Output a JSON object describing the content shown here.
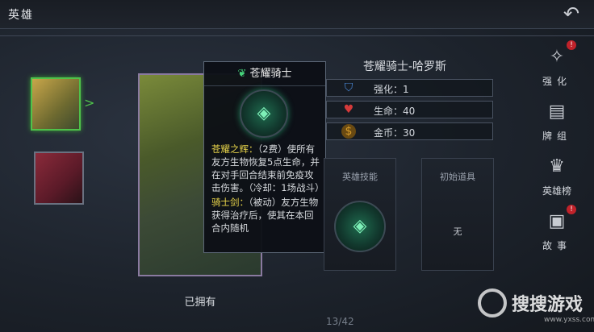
{
  "topbar": {
    "title": "英雄",
    "back_icon": "back-arrow-icon"
  },
  "hero_list": {
    "items": [
      {
        "name": "hero-thumb-knight",
        "selected": true
      },
      {
        "name": "hero-thumb-dark",
        "selected": false
      }
    ]
  },
  "hero_card": {
    "owned_label": "已拥有",
    "page_count": "13/42"
  },
  "tooltip": {
    "title": "苍耀骑士",
    "skill1_name": "苍耀之辉：",
    "skill1_text": "（2费）使所有友方生物恢复5点生命，并在对手回合结束前免疫攻击伤害。（冷却：1场战斗）",
    "skill2_name": "骑士剑：",
    "skill2_text": "（被动）友方生物获得治疗后，使其在本回合内随机"
  },
  "hero_info": {
    "name": "苍耀骑士-哈罗斯",
    "stats": [
      {
        "label": "强化：1",
        "icon": "shield-icon",
        "color": "#4a8ad8"
      },
      {
        "label": "生命：40",
        "icon": "heart-icon",
        "color": "#d43a3a"
      },
      {
        "label": "金币：30",
        "icon": "coin-icon",
        "color": "#d49a2a"
      }
    ]
  },
  "boxes": {
    "skill_title": "英雄技能",
    "item_title": "初始道具",
    "item_none": "无"
  },
  "menu": {
    "items": [
      {
        "label": "强化",
        "icon": "upgrade-icon",
        "badge": "!"
      },
      {
        "label": "牌组",
        "icon": "cards-icon",
        "badge": ""
      },
      {
        "label": "英雄榜",
        "icon": "ranking-icon",
        "badge": ""
      },
      {
        "label": "故事",
        "icon": "story-icon",
        "badge": "!"
      }
    ]
  },
  "watermark": {
    "text": "搜搜游戏",
    "url": "www.yxss.com"
  },
  "colors": {
    "accent_green": "#4fc24a",
    "skill_yellow": "#e8d44a",
    "badge_red": "#c0222a"
  }
}
